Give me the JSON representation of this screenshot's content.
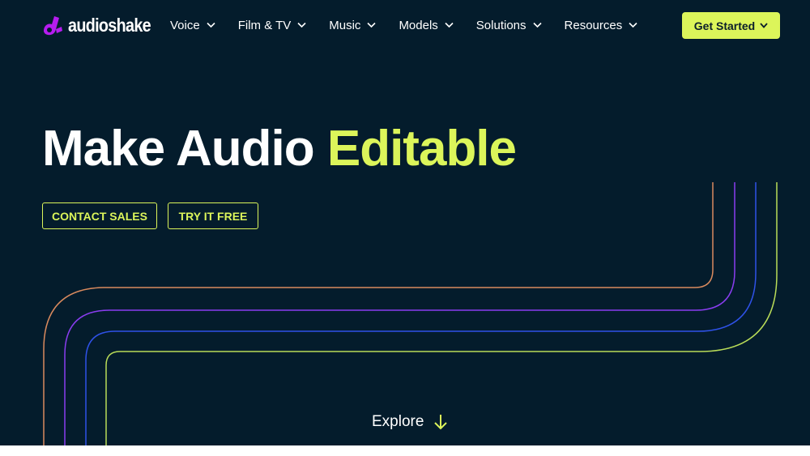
{
  "brand": {
    "name": "audioshake",
    "logo_icon": "audioshake-logo-icon",
    "colors": {
      "background": "#041c2c",
      "accent": "#dcf55a",
      "logo": "#b61cf0"
    }
  },
  "nav": {
    "items": [
      {
        "label": "Voice"
      },
      {
        "label": "Film & TV"
      },
      {
        "label": "Music"
      },
      {
        "label": "Models"
      },
      {
        "label": "Solutions"
      },
      {
        "label": "Resources"
      }
    ],
    "cta_label": "Get Started"
  },
  "hero": {
    "title_main": "Make Audio ",
    "title_accent": "Editable",
    "contact_label": "CONTACT SALES",
    "try_label": "TRY IT FREE",
    "line_colors": [
      "#d98a5e",
      "#8a3df0",
      "#2f52e8",
      "#b9dc58"
    ]
  },
  "explore": {
    "label": "Explore",
    "icon": "arrow-down-icon"
  }
}
